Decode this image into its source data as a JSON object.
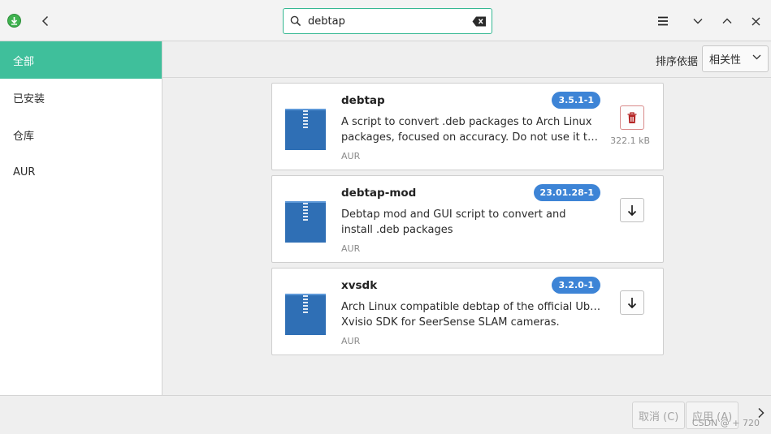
{
  "header": {
    "search_value": "debtap",
    "icons": {
      "app": "download-arrow-icon",
      "back": "chevron-left-icon",
      "search": "search-icon",
      "clear": "backspace-clear-icon",
      "menu": "hamburger-menu-icon",
      "down": "chevron-down-icon",
      "up": "chevron-up-icon",
      "close": "close-icon"
    }
  },
  "sidebar": {
    "items": [
      {
        "label": "全部",
        "active": true
      },
      {
        "label": "已安装",
        "active": false
      },
      {
        "label": "仓库",
        "active": false
      },
      {
        "label": "AUR",
        "active": false
      }
    ]
  },
  "sortbar": {
    "label": "排序依据",
    "selected": "相关性"
  },
  "packages": [
    {
      "name": "debtap",
      "version": "3.5.1-1",
      "desc_line1": "A script to convert .deb packages to Arch Linux",
      "desc_line2": "packages, focused on accuracy. Do not use it to co...",
      "repo": "AUR",
      "size": "322.1 kB",
      "action": "remove"
    },
    {
      "name": "debtap-mod",
      "version": "23.01.28-1",
      "desc_line1": "Debtap mod and GUI script to convert and",
      "desc_line2": "install .deb packages",
      "repo": "AUR",
      "size": "",
      "action": "install"
    },
    {
      "name": "xvsdk",
      "version": "3.2.0-1",
      "desc_line1": "Arch Linux compatible debtap of the official Ubuntu",
      "desc_line2": "Xvisio SDK for SeerSense SLAM cameras.",
      "repo": "AUR",
      "size": "",
      "action": "install"
    }
  ],
  "bottombar": {
    "cancel_label": "取消 (C)",
    "apply_label": "应用 (A)",
    "watermark": "CSDN @ + 720"
  },
  "colors": {
    "accent": "#3fbf9b",
    "badge": "#3d84d6",
    "search_border": "#35b892"
  }
}
